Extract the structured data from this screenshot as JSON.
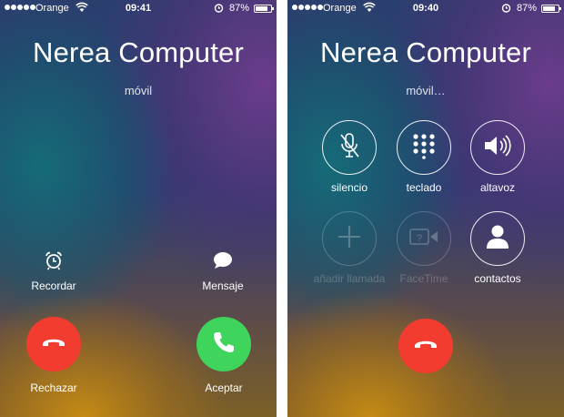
{
  "incoming": {
    "status": {
      "carrier": "Orange",
      "time": "09:41",
      "battery": "87%"
    },
    "caller": "Nerea Computer",
    "subtitle": "móvil",
    "remind_label": "Recordar",
    "message_label": "Mensaje",
    "decline_label": "Rechazar",
    "accept_label": "Aceptar"
  },
  "outgoing": {
    "status": {
      "carrier": "Orange",
      "time": "09:40",
      "battery": "87%"
    },
    "caller": "Nerea Computer",
    "subtitle": "móvil…",
    "buttons": {
      "mute": "silencio",
      "keypad": "teclado",
      "speaker": "altavoz",
      "add_call": "añadir llamada",
      "facetime": "FaceTime",
      "contacts": "contactos"
    }
  },
  "colors": {
    "decline": "#f23c30",
    "accept": "#3fd45c"
  },
  "icons": [
    "alarm-clock-icon",
    "message-bubble-icon",
    "phone-hangup-icon",
    "phone-icon",
    "microphone-off-icon",
    "keypad-icon",
    "speaker-icon",
    "plus-icon",
    "facetime-icon",
    "contact-icon",
    "wifi-icon",
    "battery-icon"
  ]
}
